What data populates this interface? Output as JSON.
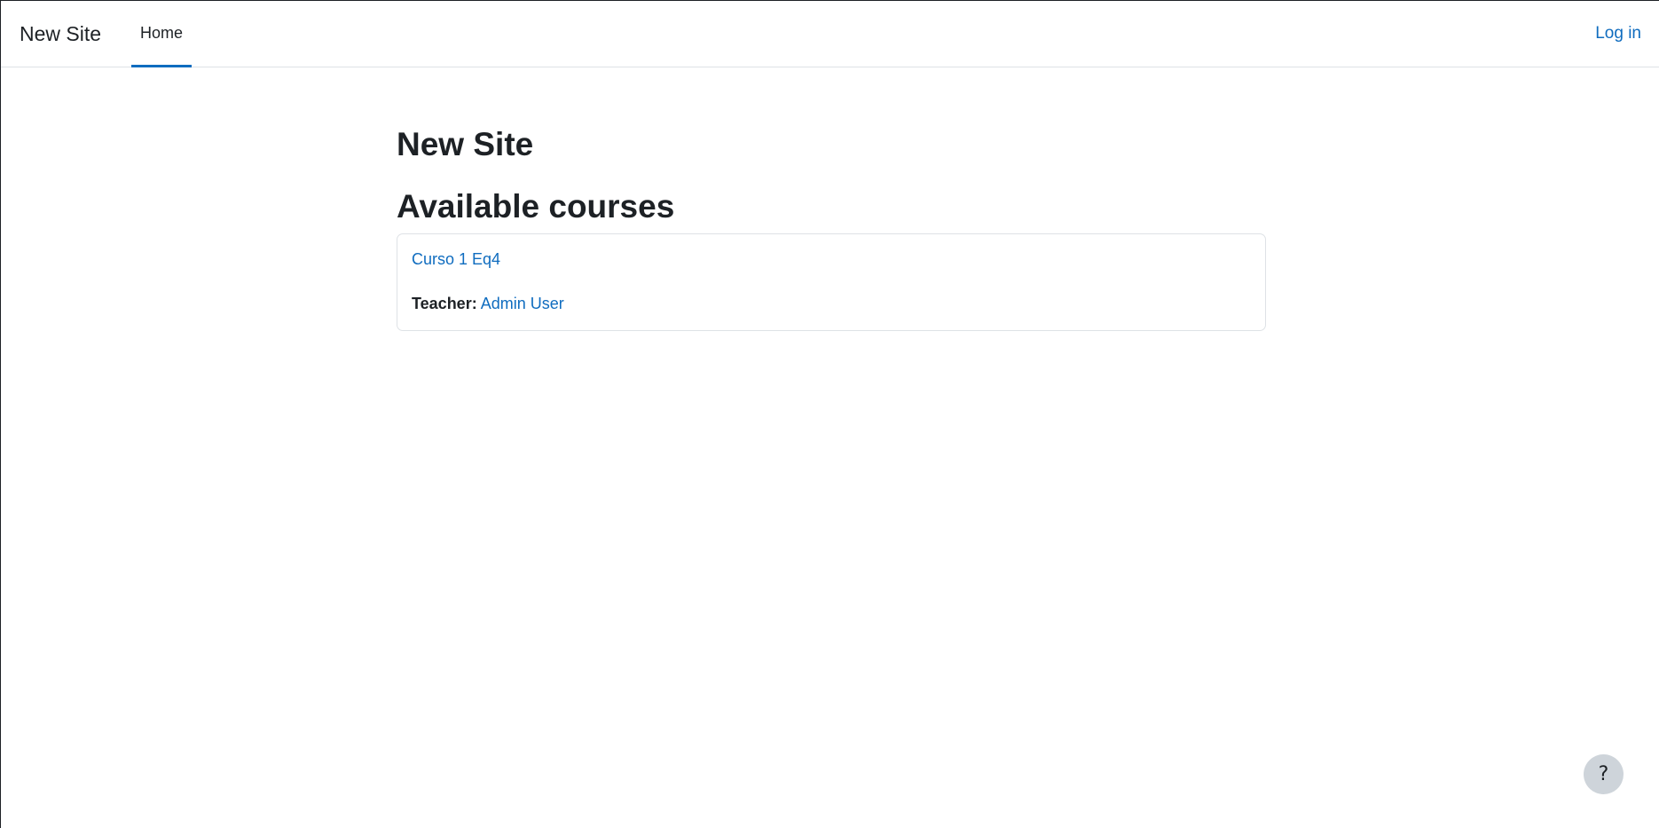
{
  "navbar": {
    "brand": "New Site",
    "tabs": [
      {
        "label": "Home",
        "active": true
      }
    ],
    "login_label": "Log in"
  },
  "main": {
    "page_title": "New Site",
    "section_title": "Available courses",
    "courses": [
      {
        "name": "Curso 1 Eq4",
        "teacher_label": "Teacher:",
        "teacher_name": "Admin User"
      }
    ]
  },
  "help": {
    "icon": "question-icon",
    "label": "?"
  },
  "colors": {
    "accent": "#0f6cbf",
    "text": "#1d2125",
    "border": "#dee2e6",
    "help_bg": "#ced4da"
  }
}
